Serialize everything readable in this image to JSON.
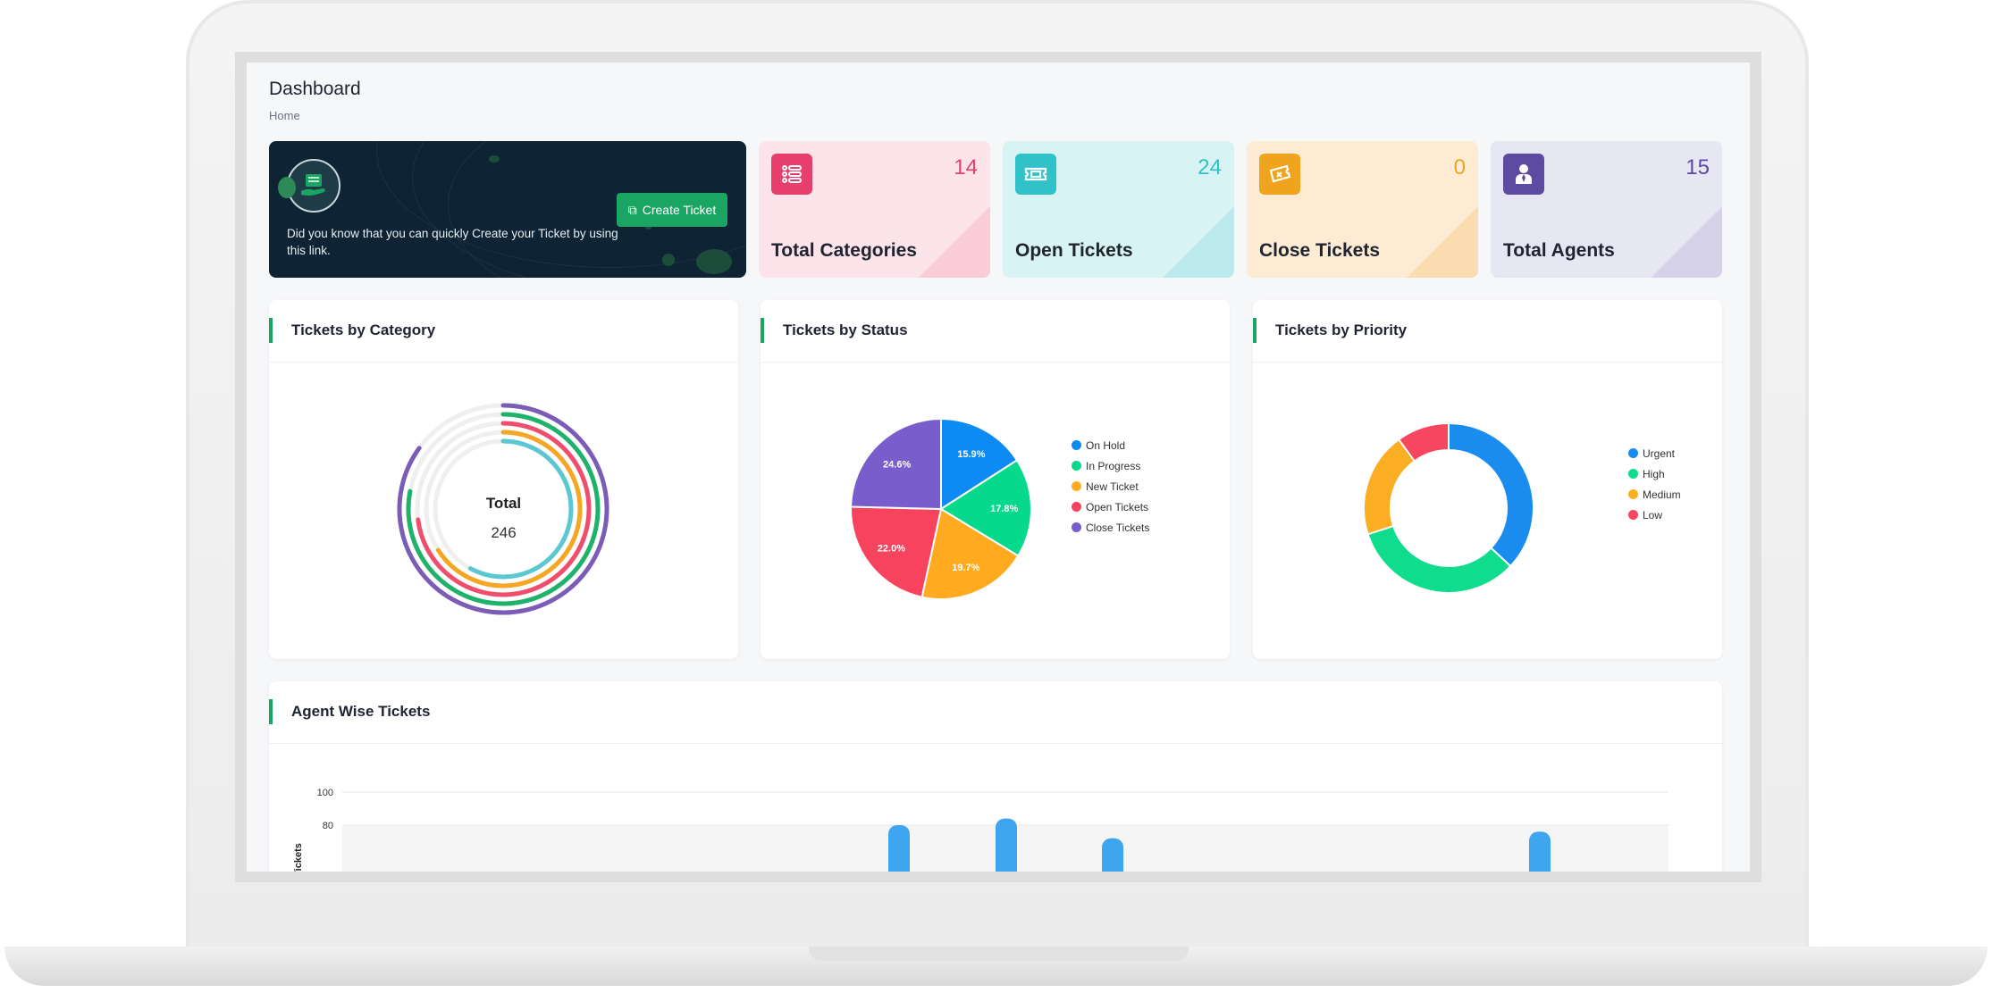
{
  "header": {
    "title": "Dashboard",
    "breadcrumb": "Home"
  },
  "promo": {
    "text": "Did you know that you can quickly Create your Ticket by using this link.",
    "button_label": "Create Ticket"
  },
  "stats": [
    {
      "label": "Total Categories",
      "value": "14",
      "color": "#e83e6c",
      "bg": "#fde4ea"
    },
    {
      "label": "Open Tickets",
      "value": "24",
      "color": "#2fc3c9",
      "bg": "#d7f3f4"
    },
    {
      "label": "Close Tickets",
      "value": "0",
      "color": "#f0a31c",
      "bg": "#fdecd3"
    },
    {
      "label": "Total Agents",
      "value": "15",
      "color": "#5c4aa3",
      "bg": "#e7e6f3"
    }
  ],
  "category_card": {
    "title": "Tickets by Category",
    "center_label": "Total",
    "center_value": "246"
  },
  "status_card": {
    "title": "Tickets by Status"
  },
  "priority_card": {
    "title": "Tickets by Priority"
  },
  "agent_card": {
    "title": "Agent Wise Tickets"
  },
  "chart_data": [
    {
      "type": "radialBar",
      "title": "Tickets by Category",
      "total": 246,
      "series": [
        {
          "color": "#7b5cb6",
          "value": 85
        },
        {
          "color": "#1fb26b",
          "value": 78
        },
        {
          "color": "#ef4f6c",
          "value": 73
        },
        {
          "color": "#f6a623",
          "value": 66
        },
        {
          "color": "#5bc8d1",
          "value": 58
        }
      ]
    },
    {
      "type": "pie",
      "title": "Tickets by Status",
      "labels": [
        "On Hold",
        "In Progress",
        "New Ticket",
        "Open Tickets",
        "Close Tickets"
      ],
      "values": [
        15.9,
        17.8,
        19.7,
        22.0,
        24.6
      ],
      "colors": [
        "#0d8bf2",
        "#06d88c",
        "#ffaa1f",
        "#f7435e",
        "#7a5dcc"
      ]
    },
    {
      "type": "donut",
      "title": "Tickets by Priority",
      "labels": [
        "Urgent",
        "High",
        "Medium",
        "Low"
      ],
      "values": [
        37,
        33,
        20,
        10
      ],
      "colors": [
        "#1a8cf0",
        "#0fdc8c",
        "#fbae22",
        "#f7465f"
      ]
    },
    {
      "type": "bar",
      "title": "Agent Wise Tickets",
      "ylabel": "Tickets",
      "yticks": [
        "100",
        "80"
      ],
      "ylim": [
        0,
        100
      ],
      "values": [
        80,
        84,
        72,
        76
      ],
      "color": "#3ea6ee"
    }
  ]
}
